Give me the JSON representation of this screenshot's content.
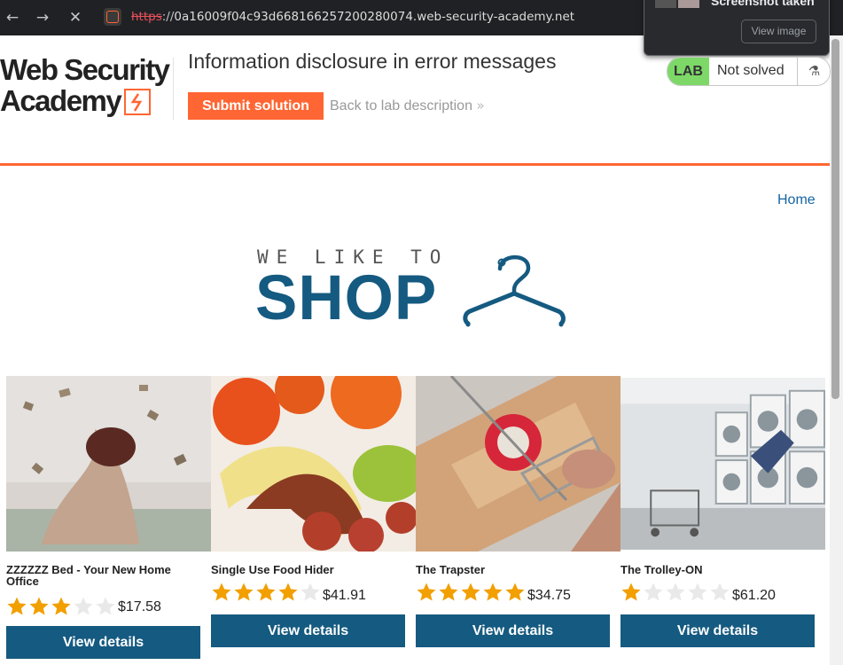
{
  "browser": {
    "url_scheme": "https",
    "url_sep": "://",
    "url_host": "0a16009f04c93d668166257200280074.web-security-academy.net",
    "toast_title": "Screenshot taken",
    "toast_button": "View image",
    "icons": [
      "back-icon",
      "forward-icon",
      "stop-icon",
      "site-icon",
      "star-icon",
      "extension-icon",
      "account-icon",
      "more-icon"
    ]
  },
  "header": {
    "logo_line1": "Web Security",
    "logo_line2": "Academy",
    "lab_title": "Information disclosure in error messages",
    "submit_label": "Submit solution",
    "back_label": "Back to lab description",
    "back_arrows": "»",
    "lab_badge": "LAB",
    "status_text": "Not solved",
    "accent": "#ff6633",
    "lab_green": "#7dd868"
  },
  "shop": {
    "home_label": "Home",
    "logo_top": "WE LIKE TO",
    "logo_main": "SHOP",
    "brand_blue": "#155a80",
    "view_details_label": "View details",
    "products": [
      {
        "name": "ZZZZZZ Bed - Your New Home Office",
        "rating": 3,
        "price": "$17.58"
      },
      {
        "name": "Single Use Food Hider",
        "rating": 4,
        "price": "$41.91"
      },
      {
        "name": "The Trapster",
        "rating": 5,
        "price": "$34.75"
      },
      {
        "name": "The Trolley-ON",
        "rating": 1,
        "price": "$61.20"
      }
    ]
  }
}
